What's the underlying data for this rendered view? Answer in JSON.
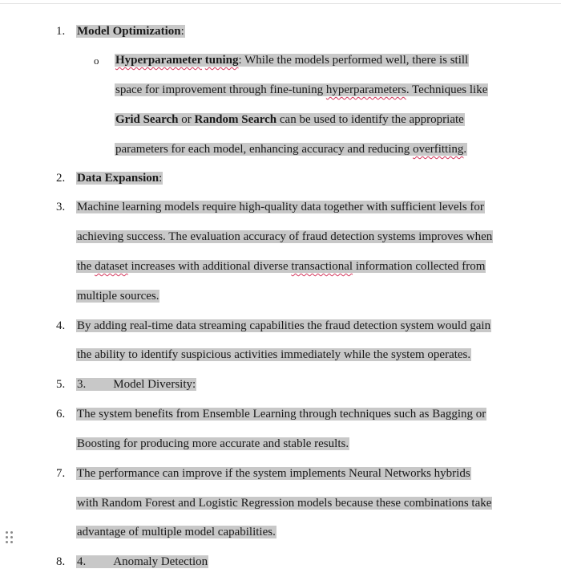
{
  "items": {
    "n1": "1.",
    "i1_title": "Model Optimization",
    "i1_colon": ":",
    "sub_bullet": "o",
    "sub_title_a": "Hyperparameter",
    "sub_title_b": "tuning",
    "sub_l1_rest": ": While the models performed well, there is still",
    "sub_l2_a": "space for improvement through fine-tuning ",
    "sub_l2_b": "hyperparameters",
    "sub_l2_c": ". Techniques like",
    "sub_l3_a": "Grid Search",
    "sub_l3_b": " or ",
    "sub_l3_c": "Random Search",
    "sub_l3_d": " can be used to identify the appropriate",
    "sub_l4_a": "parameters for each model, enhancing accuracy and reducing ",
    "sub_l4_b": "overfitting",
    "sub_l4_c": ".",
    "n2": "2.",
    "i2_title": "Data Expansion",
    "i2_colon": ":",
    "n3": "3.",
    "i3_l1": "Machine learning models require high-quality data together with sufficient levels for",
    "i3_l2": "achieving success. The evaluation accuracy of fraud detection systems improves when",
    "i3_l3_a": "the ",
    "i3_l3_b": "dataset",
    "i3_l3_c": " increases with additional diverse ",
    "i3_l3_d": "transactional",
    "i3_l3_e": " information collected from",
    "i3_l4": "multiple sources.",
    "n4": "4.",
    "i4_l1": "By adding real-time data streaming capabilities the fraud detection system would gain",
    "i4_l2": "the ability to identify suspicious activities immediately while the system operates.",
    "n5": "5.",
    "i5_prefix": "3.",
    "i5_text": "Model Diversity:",
    "n6": "6.",
    "i6_l1": "The system benefits from Ensemble Learning through techniques such as Bagging or",
    "i6_l2": "Boosting for producing more accurate and stable results.",
    "n7": "7.",
    "i7_l1": "The performance can improve if the system implements Neural Networks hybrids",
    "i7_l2": "with Random Forest and Logistic Regression models because these combinations take",
    "i7_l3": "advantage of multiple model capabilities.",
    "n8": "8.",
    "i8_prefix": "4.",
    "i8_text": "Anomaly Detection"
  },
  "colors": {
    "highlight": "#c8c8c8",
    "spellcheck": "#d4345a"
  },
  "icons": {
    "drag_handle": "drag-handle-icon"
  }
}
